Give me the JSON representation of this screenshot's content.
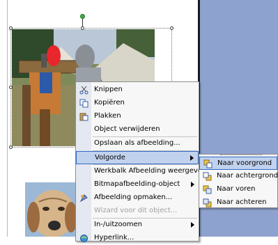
{
  "context_menu": {
    "items": [
      {
        "label": "Knippen",
        "icon": "scissors-icon",
        "enabled": true
      },
      {
        "label": "Kopiëren",
        "icon": "copy-icon",
        "enabled": true
      },
      {
        "label": "Plakken",
        "icon": "paste-icon",
        "enabled": true
      },
      {
        "label": "Object verwijderen",
        "enabled": true
      },
      {
        "label": "Opslaan als afbeelding...",
        "enabled": true
      },
      {
        "label": "Volgorde",
        "enabled": true,
        "submenu": true,
        "selected": true
      },
      {
        "label": "Werkbalk Afbeelding weergeven",
        "enabled": true
      },
      {
        "label": "Bitmapafbeelding-object",
        "enabled": true,
        "submenu": true
      },
      {
        "label": "Afbeelding opmaken...",
        "icon": "format-picture-icon",
        "enabled": true
      },
      {
        "label": "Wizard voor dit object...",
        "enabled": false
      },
      {
        "label": "In-/uitzoomen",
        "enabled": true,
        "submenu": true
      },
      {
        "label": "Hyperlink...",
        "icon": "hyperlink-icon",
        "enabled": true
      }
    ]
  },
  "submenu": {
    "items": [
      {
        "label": "Naar voorgrond",
        "icon": "bring-to-front-icon",
        "selected": true
      },
      {
        "label": "Naar achtergrond",
        "icon": "send-to-back-icon"
      },
      {
        "label": "Naar voren",
        "icon": "bring-forward-icon"
      },
      {
        "label": "Naar achteren",
        "icon": "send-backward-icon"
      }
    ]
  },
  "colors": {
    "accent_highlight": "#c1d2ee",
    "accent_border": "#316ac5",
    "workspace": "#8ea2cf"
  }
}
